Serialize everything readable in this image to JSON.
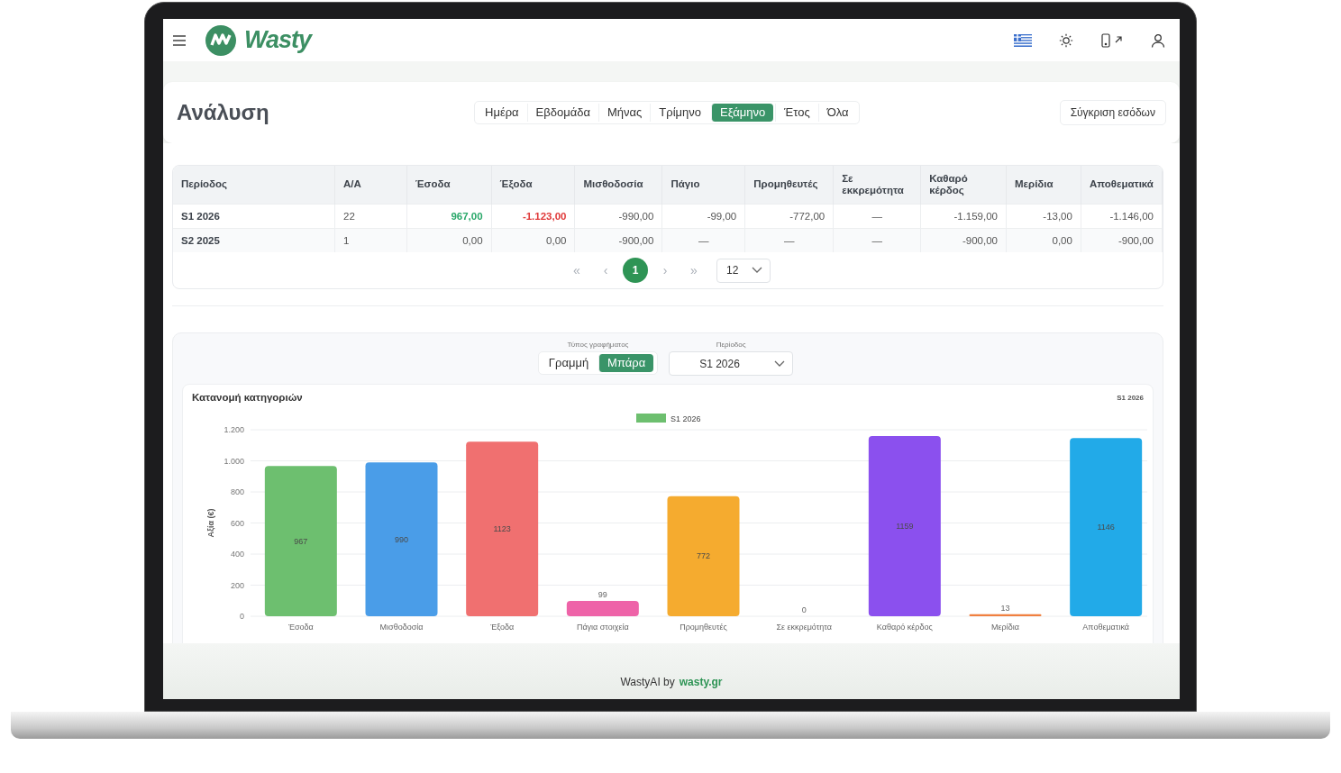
{
  "header": {
    "logo_text": "Wasty"
  },
  "page": {
    "title": "Ανάλυση",
    "periods": [
      {
        "label": "Ημέρα",
        "selected": false
      },
      {
        "label": "Εβδομάδα",
        "selected": false
      },
      {
        "label": "Μήνας",
        "selected": false
      },
      {
        "label": "Τρίμηνο",
        "selected": false
      },
      {
        "label": "Εξάμηνο",
        "selected": true
      },
      {
        "label": "Έτος",
        "selected": false
      },
      {
        "label": "Όλα",
        "selected": false
      }
    ],
    "compare_button": "Σύγκριση εσόδων"
  },
  "table": {
    "columns": [
      "Περίοδος",
      "Α/Α",
      "Έσοδα",
      "Έξοδα",
      "Μισθοδοσία",
      "Πάγιο",
      "Προμηθευτές",
      "Σε εκκρεμότητα",
      "Καθαρό κέρδος",
      "Μερίδια",
      "Αποθεματικά"
    ],
    "rows": [
      {
        "cells": [
          "S1 2026",
          "22",
          {
            "text": "967,00",
            "color": "#2aa86a"
          },
          {
            "text": "-1.123,00",
            "color": "#e03b3b"
          },
          "-990,00",
          "-99,00",
          "-772,00",
          "—",
          "-1.159,00",
          "-13,00",
          "-1.146,00"
        ]
      },
      {
        "cells": [
          "S2 2025",
          "1",
          "0,00",
          "0,00",
          "-900,00",
          "—",
          "—",
          "—",
          "-900,00",
          "0,00",
          "-900,00"
        ]
      }
    ],
    "pagination": {
      "first": "«",
      "prev": "‹",
      "pages": [
        {
          "label": "1",
          "selected": true
        }
      ],
      "next": "›",
      "last": "»",
      "page_size": "12"
    }
  },
  "chart_panel": {
    "type_label": "Τύπος γραφήματος",
    "types": [
      {
        "label": "Γραμμή",
        "selected": false
      },
      {
        "label": "Μπάρα",
        "selected": true
      }
    ],
    "period_label": "Περίοδος",
    "period_value": "S1 2026",
    "card": {
      "title": "Κατανομή κατηγοριών",
      "badge": "S1 2026",
      "chart_data": {
        "type": "bar",
        "ylabel": "Αξία (€)",
        "categories": [
          "Έσοδα",
          "Μισθοδοσία",
          "Έξοδα",
          "Πάγια στοιχεία",
          "Προμηθευτές",
          "Σε εκκρεμότητα",
          "Καθαρό κέρδος",
          "Μερίδια",
          "Αποθεματικά"
        ],
        "series": [
          {
            "name": "S1 2026",
            "color": "#6dbf6f",
            "colors": [
              "#6dbf6f",
              "#4a9de8",
              "#f07070",
              "#ee63a8",
              "#f5ab2f",
              null,
              "#8b50ee",
              "#f08040",
              "#22aae8"
            ],
            "values": [
              967,
              990,
              1123,
              99,
              772,
              0,
              1159,
              13,
              1146
            ]
          }
        ],
        "grid": true,
        "ylim": [
          0,
          1200
        ],
        "yticks": [
          {
            "value": 0,
            "label": "0"
          },
          {
            "value": 200,
            "label": "200"
          },
          {
            "value": 400,
            "label": "400"
          },
          {
            "value": 600,
            "label": "600"
          },
          {
            "value": 800,
            "label": "800"
          },
          {
            "value": 1000,
            "label": "1.000"
          },
          {
            "value": 1200,
            "label": "1.200"
          }
        ],
        "data_labels": true
      }
    }
  },
  "footer": {
    "text": "WastyAI by",
    "link": "wasty.gr"
  }
}
